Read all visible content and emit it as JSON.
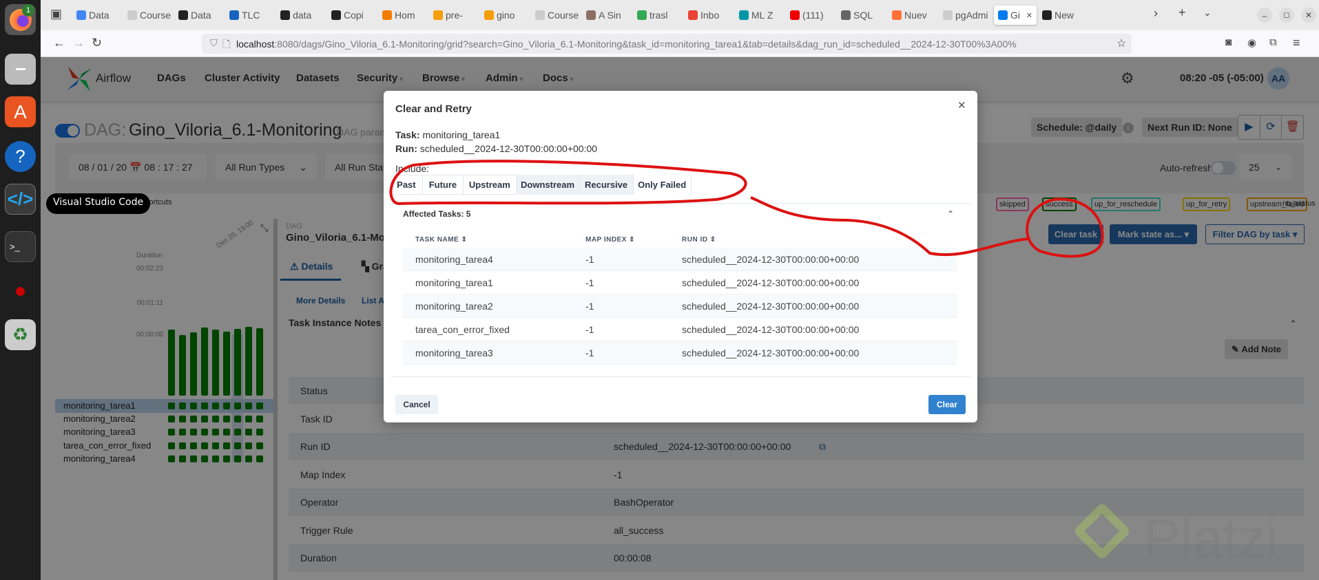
{
  "os": {
    "dock_badge": "1",
    "tooltip": "Visual Studio Code"
  },
  "browser": {
    "tabs": [
      {
        "label": "Data",
        "color": "#4285f4"
      },
      {
        "label": "Course",
        "color": "#ccc"
      },
      {
        "label": "Data",
        "color": "#222"
      },
      {
        "label": "TLC",
        "color": "#1565c0"
      },
      {
        "label": "data",
        "color": "#222"
      },
      {
        "label": "Copi",
        "color": "#222"
      },
      {
        "label": "Hom",
        "color": "#f57c00"
      },
      {
        "label": "pre-",
        "color": "#f59e0b"
      },
      {
        "label": "gino",
        "color": "#f59e0b"
      },
      {
        "label": "Course",
        "color": "#ccc"
      },
      {
        "label": "A Sin",
        "color": "#8d6e63"
      },
      {
        "label": "trasl",
        "color": "#34a853"
      },
      {
        "label": "Inbo",
        "color": "#ea4335"
      },
      {
        "label": "ML Z",
        "color": "#0097a7"
      },
      {
        "label": "(111)",
        "color": "#e00"
      },
      {
        "label": "SQL",
        "color": "#666"
      },
      {
        "label": "Nuev",
        "color": "#ff7139"
      },
      {
        "label": "pgAdmi",
        "color": "#ccc"
      },
      {
        "label": "Gi",
        "color": "#017cee",
        "active": true
      },
      {
        "label": "New",
        "color": "#222"
      }
    ],
    "url_host": "localhost",
    "url_rest": ":8080/dags/Gino_Viloria_6.1-Monitoring/grid?search=Gino_Viloria_6.1-Monitoring&task_id=monitoring_tarea1&tab=details&dag_run_id=scheduled__2024-12-30T00%3A00%"
  },
  "airflow": {
    "brand": "Airflow",
    "nav": [
      {
        "label": "DAGs"
      },
      {
        "label": "Cluster Activity"
      },
      {
        "label": "Datasets"
      },
      {
        "label": "Security",
        "caret": true
      },
      {
        "label": "Browse",
        "caret": true
      },
      {
        "label": "Admin",
        "caret": true
      },
      {
        "label": "Docs",
        "caret": true
      }
    ],
    "time": "08:20 -05 (-05:00)",
    "avatar": "AA",
    "dag_prefix": "DAG:",
    "dag_name": "Gino_Viloria_6.1-Monitoring",
    "dag_params": "DAG params",
    "schedule": "Schedule: @daily",
    "next_run": "Next Run ID: None",
    "filters": {
      "date": "08 / 01 / 20",
      "time": "08 : 17 : 27",
      "run_types": "All Run Types",
      "run_states": "All Run States",
      "auto_refresh": "Auto-refresh",
      "page_size": "25"
    },
    "shortcuts": "Shortcuts",
    "legend": [
      {
        "label": "skipped",
        "color": "#ff69b4"
      },
      {
        "label": "success",
        "color": "#008000"
      },
      {
        "label": "up_for_reschedule",
        "color": "#40e0d0"
      },
      {
        "label": "up_for_retry",
        "color": "#ffd700"
      },
      {
        "label": "upstream_failed",
        "color": "#ffa500"
      }
    ],
    "legend_nostatus": "no_status",
    "grid": {
      "duration_label": "Duration",
      "axis": [
        "00:02:23",
        "00:01:11",
        "00:00:00"
      ],
      "run_label": "Dec 29, 19:00",
      "max_seconds": 143,
      "durations": [
        134,
        124,
        129,
        139,
        134,
        131,
        136,
        140,
        137
      ],
      "tasks": [
        "monitoring_tarea1",
        "monitoring_tarea2",
        "monitoring_tarea3",
        "tarea_con_error_fixed",
        "monitoring_tarea4"
      ],
      "selected_task": 0,
      "selected_run": 6
    },
    "details": {
      "small": "DAG",
      "name": "Gino_Viloria_6.1-Monitoring",
      "tab_details": "Details",
      "tab_graph": "Graph",
      "more_details": "More Details",
      "list": "List All",
      "notes_title": "Task Instance Notes",
      "add_note": "Add Note",
      "clear_task": "Clear task",
      "mark_state": "Mark state as...",
      "filter_dag": "Filter DAG by task",
      "rows": [
        {
          "k": "Status",
          "v": ""
        },
        {
          "k": "Task ID",
          "v": ""
        },
        {
          "k": "Run ID",
          "v": "scheduled__2024-12-30T00:00:00+00:00"
        },
        {
          "k": "Map Index",
          "v": "-1"
        },
        {
          "k": "Operator",
          "v": "BashOperator"
        },
        {
          "k": "Trigger Rule",
          "v": "all_success"
        },
        {
          "k": "Duration",
          "v": "00:00:08"
        }
      ]
    }
  },
  "modal": {
    "title": "Clear and Retry",
    "task_label": "Task:",
    "task": "monitoring_tarea1",
    "run_label": "Run:",
    "run": "scheduled__2024-12-30T00:00:00+00:00",
    "include_label": "Include:",
    "include": [
      {
        "label": "Past",
        "w": 30,
        "sel": false
      },
      {
        "label": "Future",
        "w": 38,
        "sel": false
      },
      {
        "label": "Upstream",
        "w": 49,
        "sel": false
      },
      {
        "label": "Downstream",
        "w": 59,
        "sel": true
      },
      {
        "label": "Recursive",
        "w": 50,
        "sel": true
      },
      {
        "label": "Only Failed",
        "w": 54,
        "sel": false
      }
    ],
    "affected": "Affected Tasks: 5",
    "columns": [
      "TASK NAME",
      "MAP INDEX",
      "RUN ID"
    ],
    "rows": [
      {
        "task": "monitoring_tarea4",
        "map": "-1",
        "run": "scheduled__2024-12-30T00:00:00+00:00"
      },
      {
        "task": "monitoring_tarea1",
        "map": "-1",
        "run": "scheduled__2024-12-30T00:00:00+00:00"
      },
      {
        "task": "monitoring_tarea2",
        "map": "-1",
        "run": "scheduled__2024-12-30T00:00:00+00:00"
      },
      {
        "task": "tarea_con_error_fixed",
        "map": "-1",
        "run": "scheduled__2024-12-30T00:00:00+00:00"
      },
      {
        "task": "monitoring_tarea3",
        "map": "-1",
        "run": "scheduled__2024-12-30T00:00:00+00:00"
      }
    ],
    "cancel": "Cancel",
    "clear": "Clear"
  },
  "watermark": "Platzi",
  "colors": {
    "accent": "#017cee",
    "primary_btn": "#3182ce",
    "annotation": "#d11"
  }
}
